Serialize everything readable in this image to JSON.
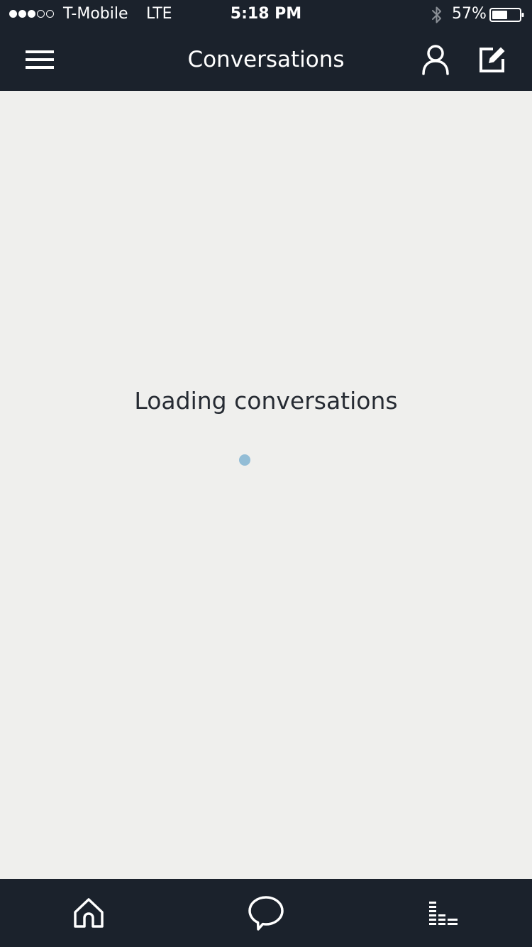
{
  "status_bar": {
    "carrier": "T-Mobile",
    "network": "LTE",
    "time": "5:18 PM",
    "battery_percent": "57%",
    "battery_level": 0.57,
    "signal_bars_filled": 3,
    "signal_bars_total": 5
  },
  "nav": {
    "title": "Conversations",
    "menu_icon": "hamburger-menu-icon",
    "profile_icon": "person-icon",
    "compose_icon": "compose-icon"
  },
  "main": {
    "loading_text": "Loading conversations"
  },
  "tab_bar": {
    "tabs": [
      {
        "id": "home",
        "icon": "home-icon"
      },
      {
        "id": "conversations",
        "icon": "speech-bubble-icon",
        "active": true
      },
      {
        "id": "activity",
        "icon": "equalizer-bars-icon"
      }
    ]
  },
  "colors": {
    "bar_background": "#1b222c",
    "content_background": "#efefed",
    "text_dark": "#262b33",
    "spinner": "#93bdd6",
    "icon_white": "#ffffff"
  }
}
